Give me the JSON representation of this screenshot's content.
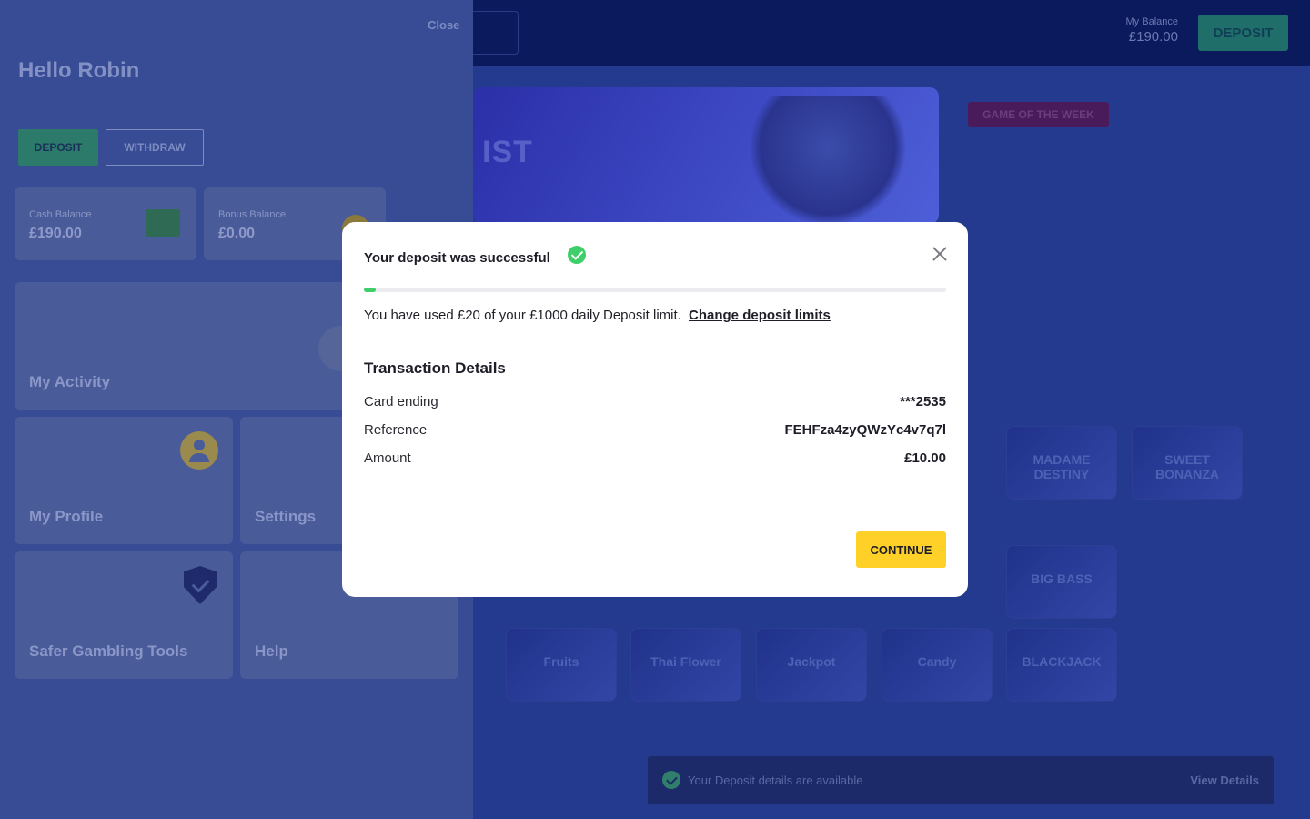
{
  "header": {
    "balance_label": "My Balance",
    "balance_value": "£190.00",
    "deposit_label": "DEPOSIT"
  },
  "hero": {
    "title_fragment": "IST",
    "game_of_week_label": "GAME OF THE WEEK"
  },
  "game_tiles": {
    "row1": [
      "MADAME DESTINY",
      "SWEET BONANZA"
    ],
    "row3": [
      "Fruits",
      "Thai Flower",
      "Jackpot",
      "Candy",
      "BLACKJACK"
    ],
    "row2_extra": [
      "BIG BASS"
    ]
  },
  "toast": {
    "message": "Your Deposit details are available",
    "link_label": "View Details"
  },
  "panel": {
    "close_label": "Close",
    "greeting": "Hello Robin",
    "deposit_label": "DEPOSIT",
    "withdraw_label": "WITHDRAW",
    "cash_balance_label": "Cash Balance",
    "cash_balance_value": "£190.00",
    "bonus_balance_label": "Bonus Balance",
    "bonus_balance_value": "£0.00",
    "tiles": {
      "activity": "My Activity",
      "profile": "My Profile",
      "settings": "Settings",
      "safer": "Safer Gambling Tools",
      "help": "Help"
    }
  },
  "modal": {
    "title": "Your deposit was successful",
    "limit_used_fraction": 0.02,
    "limit_text": "You have used £20 of your £1000 daily Deposit limit.",
    "limit_link": "Change deposit limits",
    "section_title": "Transaction Details",
    "rows": [
      {
        "label": "Card ending",
        "value": "***2535"
      },
      {
        "label": "Reference",
        "value": "FEHFza4zyQWzYc4v7q7l"
      },
      {
        "label": "Amount",
        "value": "£10.00"
      }
    ],
    "continue_label": "CONTINUE"
  },
  "colors": {
    "accent_yellow": "#ffd028",
    "success_green": "#3ecf6a",
    "panel_blue": "#374c94",
    "header_navy": "#0b1a5c"
  }
}
